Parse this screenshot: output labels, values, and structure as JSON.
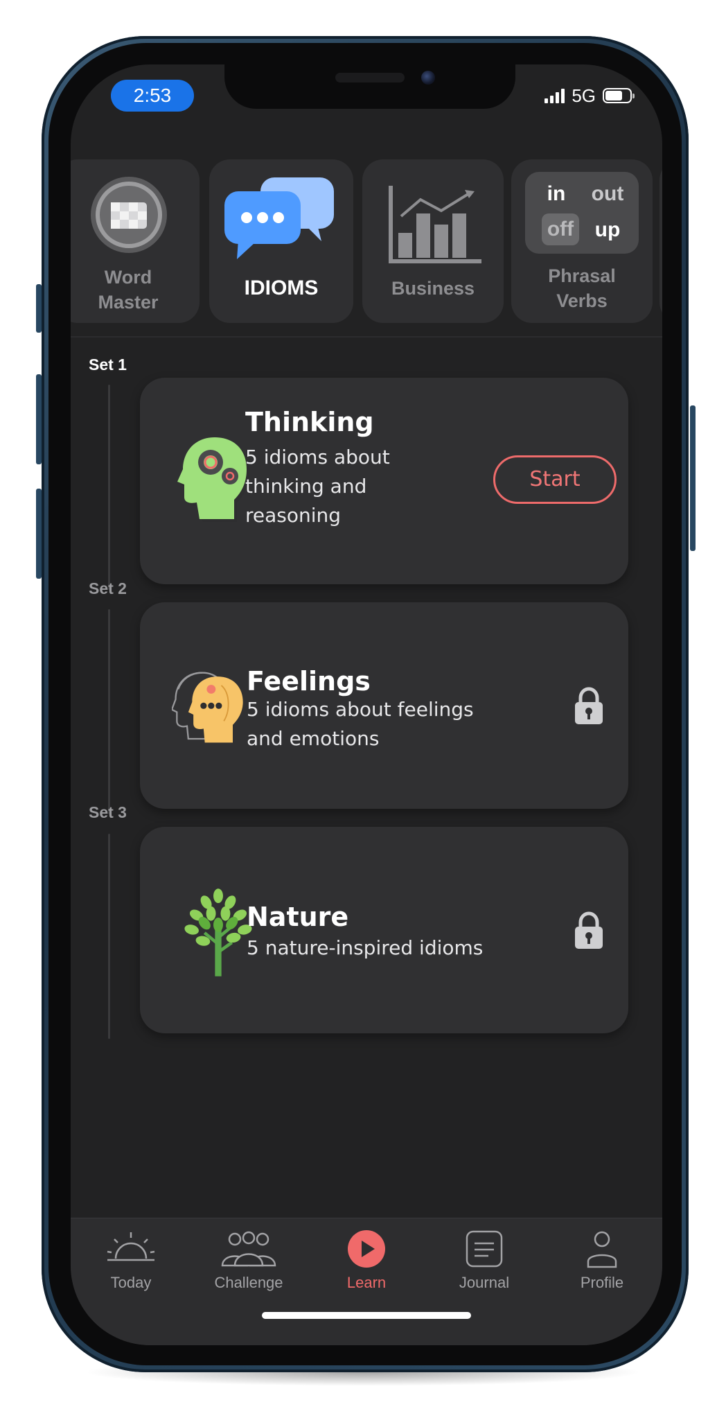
{
  "status_bar": {
    "time": "2:53",
    "network": "5G",
    "battery_level": 0.7
  },
  "categories": [
    {
      "label": "Word Master",
      "active": false
    },
    {
      "label": "IDIOMS",
      "active": true
    },
    {
      "label": "Business",
      "active": false
    },
    {
      "label": "Phrasal Verbs",
      "active": false,
      "words": [
        "in",
        "out",
        "off",
        "up"
      ]
    }
  ],
  "sets": [
    {
      "label": "Set 1",
      "title": "Thinking",
      "description": "5 idioms about thinking and reasoning",
      "action": "Start"
    },
    {
      "label": "Set 2",
      "title": "Feelings",
      "description": "5 idioms about feelings and emotions",
      "locked": true
    },
    {
      "label": "Set 3",
      "title": "Nature",
      "description": "5 nature-inspired idioms",
      "locked": true
    }
  ],
  "tabs": [
    {
      "label": "Today",
      "icon": "sunrise-icon"
    },
    {
      "label": "Challenge",
      "icon": "group-icon"
    },
    {
      "label": "Learn",
      "icon": "play-icon",
      "active": true
    },
    {
      "label": "Journal",
      "icon": "journal-icon"
    },
    {
      "label": "Profile",
      "icon": "profile-icon"
    }
  ],
  "colors": {
    "accent": "#F06A6A",
    "background": "#222223",
    "card": "#303032",
    "time_pill": "#1A73E8"
  }
}
